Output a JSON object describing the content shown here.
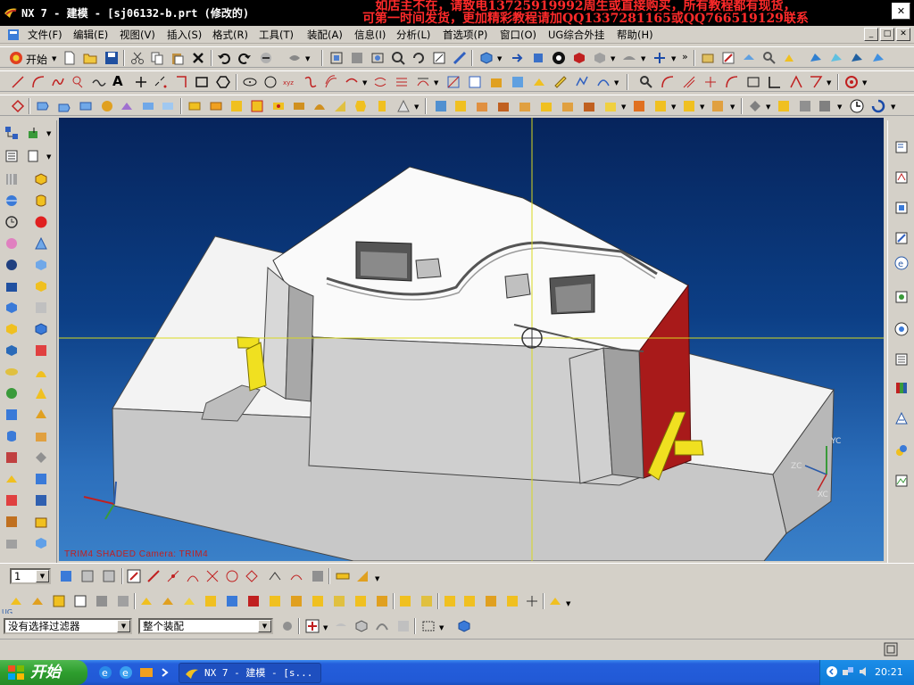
{
  "window": {
    "title": "NX 7 - 建模 - [sj06132-b.prt  (修改的)",
    "watermark_line1": "如店主不在，请致电13725919992周生或直接购买，所有教程都有现货，",
    "watermark_line2": "可第一时间发货，更加精彩教程请加QQ1337281165或QQ766519129联系",
    "min_glyph": "_",
    "max_glyph": "□",
    "close_glyph": "✕"
  },
  "menu": {
    "items": [
      "文件(F)",
      "编辑(E)",
      "视图(V)",
      "插入(S)",
      "格式(R)",
      "工具(T)",
      "装配(A)",
      "信息(I)",
      "分析(L)",
      "首选项(P)",
      "窗口(O)",
      "UG综合外挂",
      "帮助(H)"
    ]
  },
  "toolbar": {
    "start_label": "开始",
    "text_tool_label": "A"
  },
  "viewport": {
    "label": "TRIM4 SHADED  Camera: TRIM4",
    "axis_labels": [
      "ZC",
      "YC",
      "XC"
    ]
  },
  "bottom": {
    "layer_value": "1",
    "filter_value": "没有选择过滤器",
    "scope_value": "整个装配",
    "ug_tag": "UG"
  },
  "taskbar": {
    "start_label": "开始",
    "app_item": "NX 7 - 建模 - [s...",
    "clock": "20:21"
  },
  "colors": {
    "background_top": "#06245c",
    "background_bottom": "#3a80c8",
    "part_face": "#f2f2f2",
    "highlight_face": "#a81a1a",
    "insert_yellow": "#f0e020",
    "watermark": "#ff2a2a"
  }
}
